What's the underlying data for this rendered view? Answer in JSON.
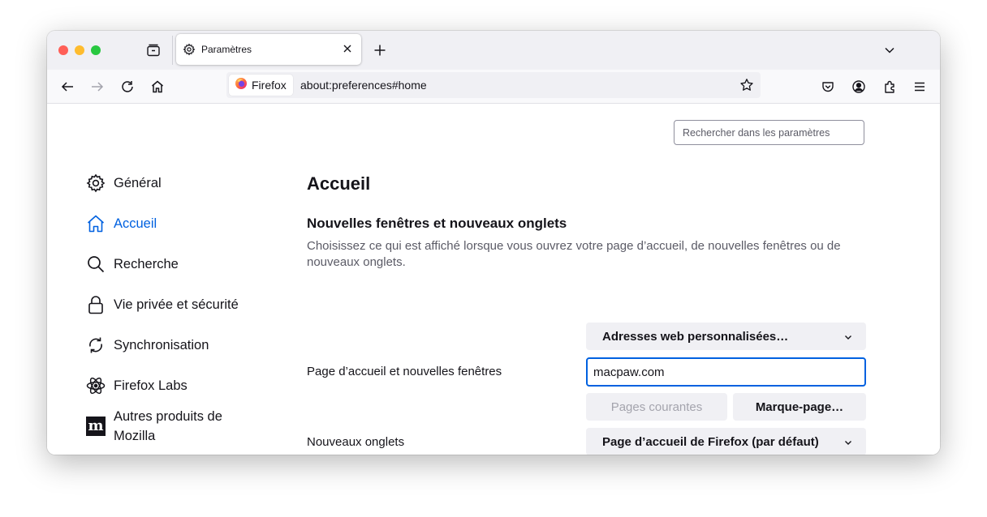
{
  "tab": {
    "title": "Paramètres"
  },
  "urlbar": {
    "identity_label": "Firefox",
    "url": "about:preferences#home"
  },
  "search": {
    "placeholder": "Rechercher dans les paramètres"
  },
  "sidebar": {
    "items": [
      {
        "label": "Général",
        "icon": "gear-icon",
        "selected": false
      },
      {
        "label": "Accueil",
        "icon": "home-icon",
        "selected": true
      },
      {
        "label": "Recherche",
        "icon": "search-icon",
        "selected": false
      },
      {
        "label": "Vie privée et sécurité",
        "icon": "lock-icon",
        "selected": false
      },
      {
        "label": "Synchronisation",
        "icon": "sync-icon",
        "selected": false
      },
      {
        "label": "Firefox Labs",
        "icon": "labs-icon",
        "selected": false
      },
      {
        "label": "Autres produits de Mozilla",
        "icon": "mozilla-logo",
        "selected": false
      }
    ]
  },
  "main": {
    "title": "Accueil",
    "section_title": "Nouvelles fenêtres et nouveaux onglets",
    "section_description": "Choisissez ce qui est affiché lorsque vous ouvrez votre page d’accueil, de nouvelles fenêtres ou de nouveaux onglets.",
    "homepage": {
      "label": "Page d’accueil et nouvelles fenêtres",
      "select_value": "Adresses web personnalisées…",
      "url_value": "macpaw.com",
      "current_pages_button": "Pages courantes",
      "bookmark_button": "Marque-page…"
    },
    "newtabs": {
      "label": "Nouveaux onglets",
      "select_value": "Page d’accueil de Firefox (par défaut)"
    }
  },
  "colors": {
    "accent": "#0061e0",
    "text": "#15141a",
    "secondary_text": "#5b5b66"
  }
}
